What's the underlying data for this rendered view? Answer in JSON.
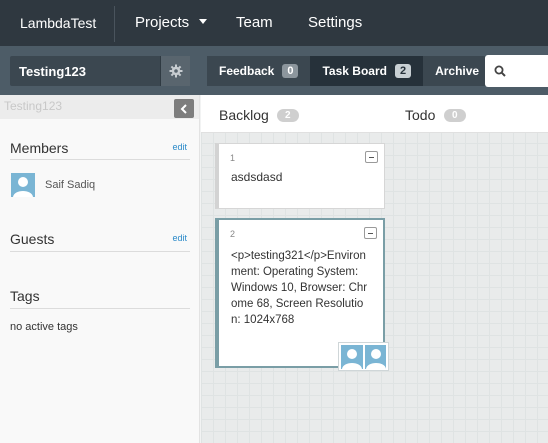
{
  "topnav": {
    "brand": "LambdaTest",
    "items": [
      {
        "label": "Projects"
      },
      {
        "label": "Team"
      },
      {
        "label": "Settings"
      }
    ]
  },
  "subbar": {
    "project_name": "Testing123",
    "tabs": [
      {
        "label": "Feedback",
        "count": "0"
      },
      {
        "label": "Task Board",
        "count": "2"
      },
      {
        "label": "Archive"
      }
    ]
  },
  "sidebar": {
    "ghost_title": "Testing123",
    "members_title": "Members",
    "members_edit": "edit",
    "member_name": "Saif Sadiq",
    "guests_title": "Guests",
    "guests_edit": "edit",
    "tags_title": "Tags",
    "tags_empty": "no active tags"
  },
  "board": {
    "columns": [
      {
        "title": "Backlog",
        "count": "2"
      },
      {
        "title": "Todo",
        "count": "0"
      }
    ],
    "cards": [
      {
        "id": "1",
        "text": "asdsdasd"
      },
      {
        "id": "2",
        "text": "<p>testing321</p>Environment: Operating System: Windows 10, Browser: Chrome 68, Screen Resolution: 1024x768"
      }
    ]
  },
  "colors": {
    "topnav_bg": "#2f3840",
    "subbar_bg": "#4d5c67",
    "active_tab_bg": "#26313a",
    "link": "#2b8ac9",
    "selected_card_border": "#7a9ea6"
  }
}
